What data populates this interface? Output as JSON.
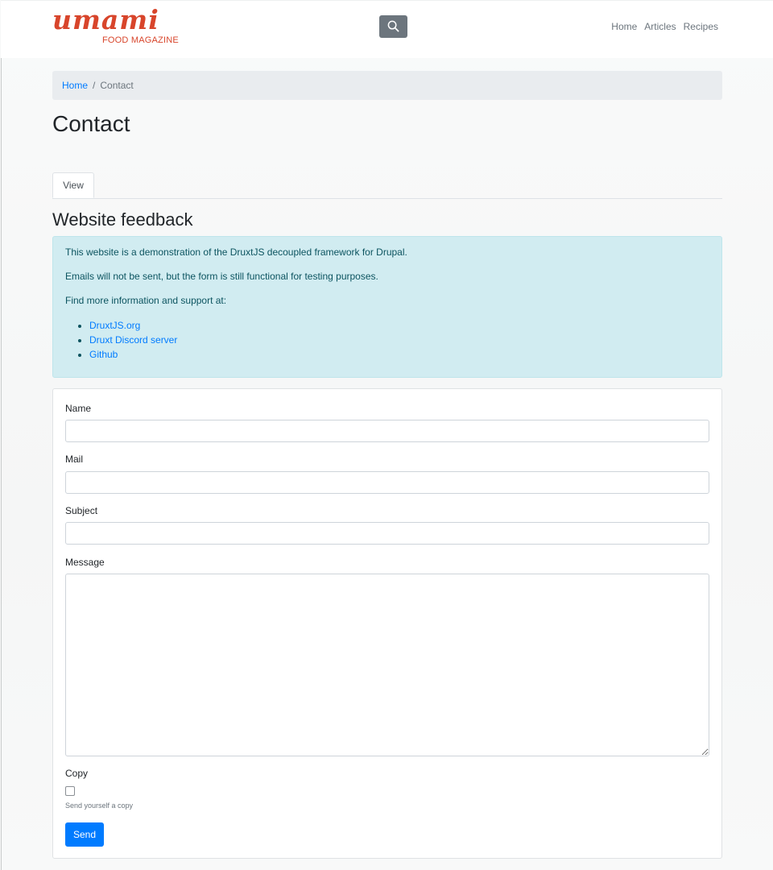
{
  "header": {
    "logo_script": "umami",
    "logo_tagline": "FOOD MAGAZINE",
    "search_icon": "search-icon",
    "nav": [
      {
        "label": "Home"
      },
      {
        "label": "Articles"
      },
      {
        "label": "Recipes"
      }
    ]
  },
  "breadcrumb": {
    "home": "Home",
    "separator": "/",
    "current": "Contact"
  },
  "page": {
    "title": "Contact",
    "tabs": [
      {
        "label": "View"
      }
    ],
    "section_title": "Website feedback"
  },
  "alert": {
    "line1": "This website is a demonstration of the DruxtJS decoupled framework for Drupal.",
    "line2": "Emails will not be sent, but the form is still functional for testing purposes.",
    "line3": "Find more information and support at:",
    "links": [
      {
        "label": "DruxtJS.org"
      },
      {
        "label": "Druxt Discord server"
      },
      {
        "label": "Github"
      }
    ]
  },
  "form": {
    "name_label": "Name",
    "name_value": "",
    "mail_label": "Mail",
    "mail_value": "",
    "subject_label": "Subject",
    "subject_value": "",
    "message_label": "Message",
    "message_value": "",
    "copy_label": "Copy",
    "copy_checked": false,
    "copy_help": "Send yourself a copy",
    "submit_label": "Send"
  },
  "colors": {
    "brand": "#d8452b",
    "primary": "#007bff",
    "info_bg": "#d1ecf1",
    "secondary": "#6c757d"
  }
}
